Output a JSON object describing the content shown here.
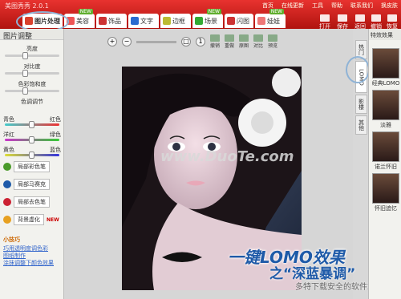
{
  "app": {
    "title": "美图秀秀 2.0.1"
  },
  "menu": [
    "首页",
    "在线更新",
    "工具",
    "帮助",
    "联系我们",
    "换皮肤"
  ],
  "tabs": [
    {
      "label": "图片处理",
      "new": false
    },
    {
      "label": "美容",
      "new": true
    },
    {
      "label": "饰品",
      "new": false
    },
    {
      "label": "文字",
      "new": false
    },
    {
      "label": "边框",
      "new": false
    },
    {
      "label": "场景",
      "new": true
    },
    {
      "label": "闪图",
      "new": false
    },
    {
      "label": "娃娃",
      "new": true
    }
  ],
  "new_badge": "NEW",
  "tools": [
    "打开",
    "保存",
    "返回",
    "撤销",
    "恢复"
  ],
  "left": {
    "header": "图片调整",
    "sliders": [
      {
        "label": "亮度",
        "value": 0.35
      },
      {
        "label": "对比度",
        "value": 0.35
      },
      {
        "label": "色彩饱和度",
        "value": 0.35
      },
      {
        "label": "色调调节",
        "value": 0.5
      }
    ],
    "color_pairs": [
      {
        "left": "青色",
        "right": "红色",
        "value": 0.5
      },
      {
        "left": "洋红",
        "right": "绿色",
        "value": 0.5
      },
      {
        "left": "黄色",
        "right": "蓝色",
        "value": 0.5
      }
    ],
    "buttons": [
      {
        "label": "局部彩色笔",
        "color": "#4a9a2a"
      },
      {
        "label": "局部马赛克",
        "color": "#1e5aa8"
      },
      {
        "label": "局部去色笔",
        "color": "#c23"
      },
      {
        "label": "背景虚化",
        "color": "#e7a020",
        "badge": "NEW"
      }
    ],
    "tips": {
      "header": "小技巧",
      "links": [
        "巧用透明度调色彩",
        "图纸制作",
        "涂抹调整下颜色效果"
      ]
    }
  },
  "canvas": {
    "buttons": [
      "撤销",
      "重做",
      "原图",
      "对比",
      "预览"
    ],
    "watermark": "www.DuoTe.com"
  },
  "slogan": {
    "line1": "一键LOMO效果",
    "line2": "之“深蓝暴调”",
    "line3": "多特下载安全的软件站"
  },
  "right": {
    "header": "特效效果",
    "vtabs": [
      "热门",
      "LOMO",
      "影楼",
      "其他"
    ],
    "thumbs": [
      "经典LOMO",
      "淡雅",
      "诺兰怀旧",
      "怀旧追忆"
    ]
  }
}
